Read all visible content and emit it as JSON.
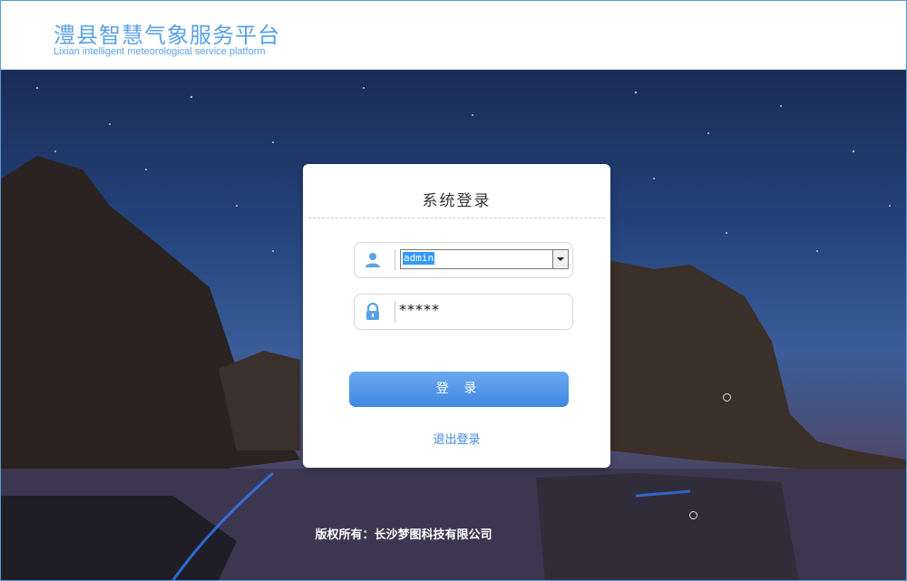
{
  "header": {
    "title_cn": "澧县智慧气象服务平台",
    "title_en": "Lixian intelligent meteorological service platform"
  },
  "login": {
    "title": "系统登录",
    "username_value": "admin",
    "password_value": "*****",
    "login_label": "登 录",
    "logout_label": "退出登录"
  },
  "footer": {
    "copyright": "版权所有：长沙梦图科技有限公司"
  },
  "colors": {
    "accent": "#5aa2e6",
    "button": "#4a90e2"
  },
  "icons": [
    "user-icon",
    "lock-icon",
    "dropdown-arrow-icon"
  ]
}
